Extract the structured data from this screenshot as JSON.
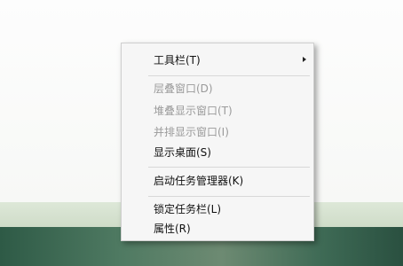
{
  "context_menu": {
    "items": [
      {
        "label": "工具栏(T)",
        "enabled": true,
        "has_submenu": true
      },
      {
        "label": "层叠窗口(D)",
        "enabled": false
      },
      {
        "label": "堆叠显示窗口(T)",
        "enabled": false
      },
      {
        "label": "并排显示窗口(I)",
        "enabled": false
      },
      {
        "label": "显示桌面(S)",
        "enabled": true
      },
      {
        "label": "启动任务管理器(K)",
        "enabled": true
      },
      {
        "label": "锁定任务栏(L)",
        "enabled": true
      },
      {
        "label": "属性(R)",
        "enabled": true
      }
    ]
  }
}
